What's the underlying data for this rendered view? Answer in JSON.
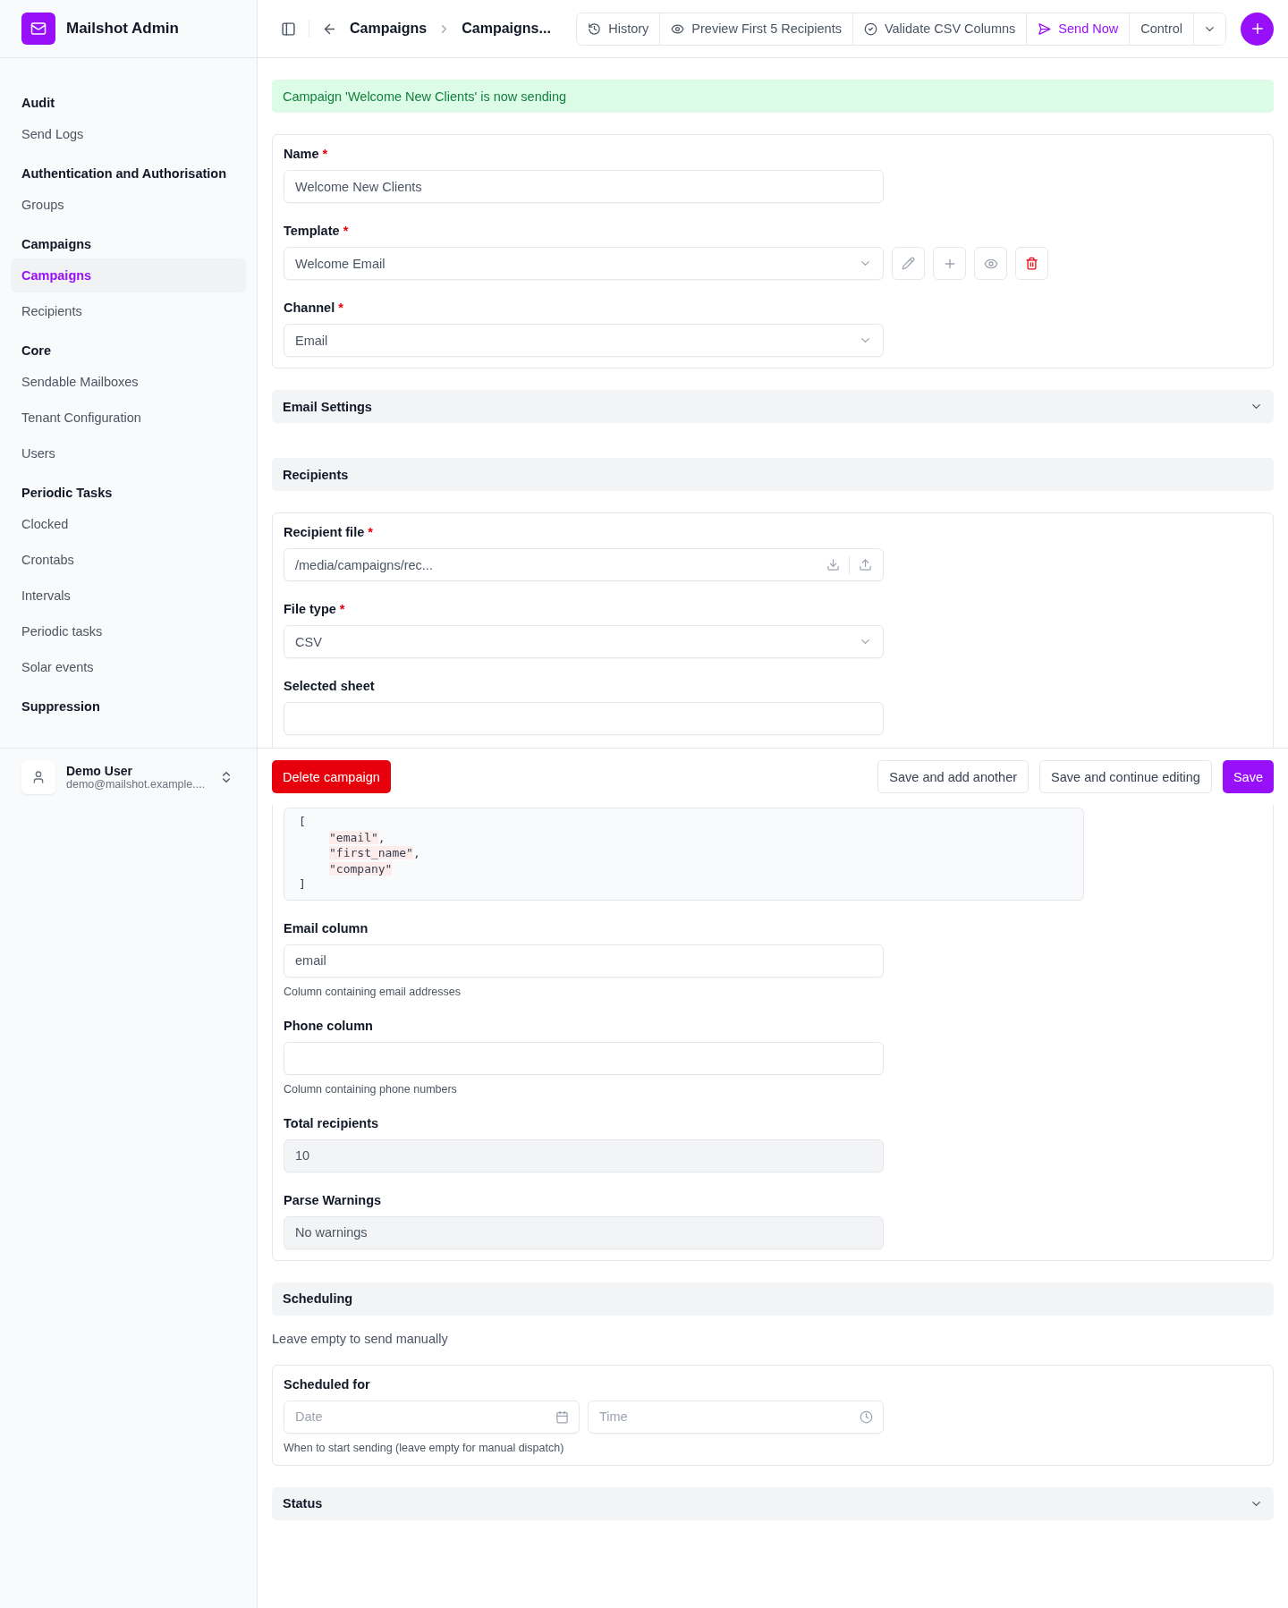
{
  "app": {
    "name": "Mailshot Admin"
  },
  "sidebar": {
    "sections": [
      {
        "title": "Audit",
        "items": [
          {
            "label": "Send Logs",
            "selected": false
          }
        ]
      },
      {
        "title": "Authentication and Authorisation",
        "items": [
          {
            "label": "Groups",
            "selected": false
          }
        ]
      },
      {
        "title": "Campaigns",
        "items": [
          {
            "label": "Campaigns",
            "selected": true
          },
          {
            "label": "Recipients",
            "selected": false
          }
        ]
      },
      {
        "title": "Core",
        "items": [
          {
            "label": "Sendable Mailboxes",
            "selected": false
          },
          {
            "label": "Tenant Configuration",
            "selected": false
          },
          {
            "label": "Users",
            "selected": false
          }
        ]
      },
      {
        "title": "Periodic Tasks",
        "items": [
          {
            "label": "Clocked",
            "selected": false
          },
          {
            "label": "Crontabs",
            "selected": false
          },
          {
            "label": "Intervals",
            "selected": false
          },
          {
            "label": "Periodic tasks",
            "selected": false
          },
          {
            "label": "Solar events",
            "selected": false
          }
        ]
      },
      {
        "title": "Suppression"
      }
    ],
    "user": {
      "name": "Demo User",
      "email": "demo@mailshot.example...."
    }
  },
  "header": {
    "breadcrumbs": [
      "Campaigns",
      "Campaigns..."
    ],
    "actions": [
      {
        "kind": "history",
        "label": "History"
      },
      {
        "kind": "preview",
        "label": "Preview First 5 Recipients"
      },
      {
        "kind": "validate",
        "label": "Validate CSV Columns"
      },
      {
        "kind": "send",
        "label": "Send Now"
      }
    ],
    "control": "Control"
  },
  "alert": "Campaign 'Welcome New Clients' is now sending",
  "sections": [
    {
      "kind": "card",
      "fields": [
        {
          "kind": "text",
          "label": "Name",
          "required_mark": "*",
          "value": "Welcome New Clients"
        },
        {
          "kind": "select",
          "label": "Template",
          "required_mark": "*",
          "value": "Welcome Email",
          "actions": [
            {
              "kind": "edit"
            },
            {
              "kind": "add"
            },
            {
              "kind": "view"
            },
            {
              "kind": "delete"
            }
          ]
        },
        {
          "kind": "select",
          "label": "Channel",
          "required_mark": "*",
          "value": "Email"
        }
      ]
    },
    {
      "kind": "collapsible",
      "title": "Email Settings",
      "collapsed": true
    },
    {
      "kind": "collapsible",
      "title": "Recipients",
      "collapsed": false
    },
    {
      "kind": "card",
      "fields": [
        {
          "kind": "file",
          "label": "Recipient file",
          "required_mark": "*",
          "value": "/media/campaigns/rec..."
        },
        {
          "kind": "select",
          "label": "File type",
          "required_mark": "*",
          "value": "CSV"
        },
        {
          "kind": "text",
          "label": "Selected sheet"
        },
        {
          "kind": "code",
          "lines": [
            {
              "text": "[",
              "string": false
            },
            {
              "text": "\"email\"",
              "string": true,
              "after": ","
            },
            {
              "text": "\"first_name\"",
              "string": true,
              "after": ","
            },
            {
              "text": "\"company\"",
              "string": true
            },
            {
              "text": "]",
              "string": false
            }
          ]
        },
        {
          "kind": "text",
          "label": "Email column",
          "value": "email",
          "help": "Column containing email addresses"
        },
        {
          "kind": "text",
          "label": "Phone column",
          "help": "Column containing phone numbers"
        },
        {
          "kind": "readonly",
          "label": "Total recipients",
          "value": "10"
        },
        {
          "kind": "readonly",
          "label": "Parse Warnings",
          "value": "No warnings"
        }
      ]
    },
    {
      "kind": "collapsible",
      "title": "Scheduling",
      "collapsed": false
    },
    {
      "kind": "note",
      "text": "Leave empty to send manually"
    },
    {
      "kind": "card",
      "fields": [
        {
          "kind": "datetime",
          "label": "Scheduled for",
          "date_placeholder": "Date",
          "time_placeholder": "Time",
          "help": "When to start sending (leave empty for manual dispatch)"
        }
      ]
    },
    {
      "kind": "collapsible",
      "title": "Status",
      "collapsed": true
    }
  ],
  "footer": {
    "delete": "Delete campaign",
    "buttons": [
      {
        "kind": "secondary",
        "label": "Save and add another"
      },
      {
        "kind": "secondary",
        "label": "Save and continue editing"
      },
      {
        "kind": "primary",
        "label": "Save"
      }
    ]
  }
}
